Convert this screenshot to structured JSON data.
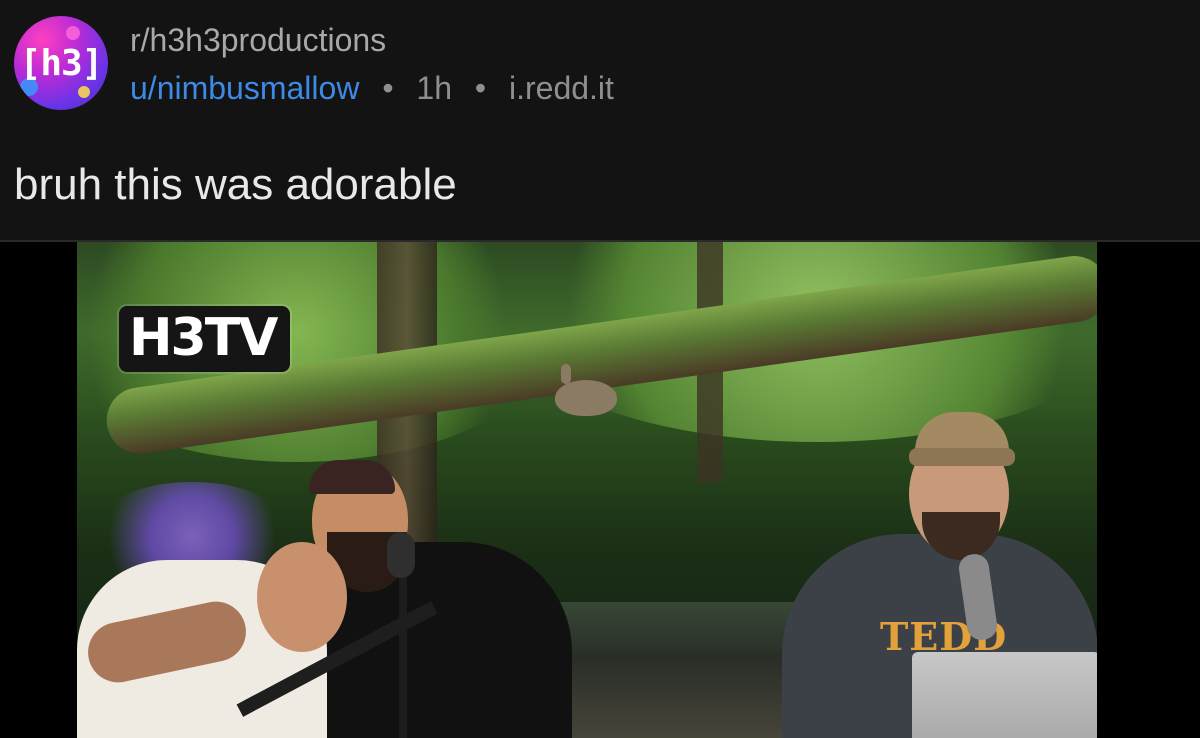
{
  "post": {
    "subreddit": "r/h3h3productions",
    "author": "u/nimbusmallow",
    "age": "1h",
    "domain": "i.redd.it",
    "title": "bruh this was adorable"
  },
  "avatar": {
    "label": "[h3]"
  },
  "media": {
    "badge": "H3TV",
    "shirt_text": "TEDD"
  },
  "icons": [
    "subreddit-avatar-icon",
    "separator-dot-icon",
    "apple-logo-icon"
  ],
  "colors": {
    "background": "#131313",
    "username": "#3d8ae6",
    "title_text": "#e8e8e8",
    "meta_text": "#8f8f8f"
  }
}
